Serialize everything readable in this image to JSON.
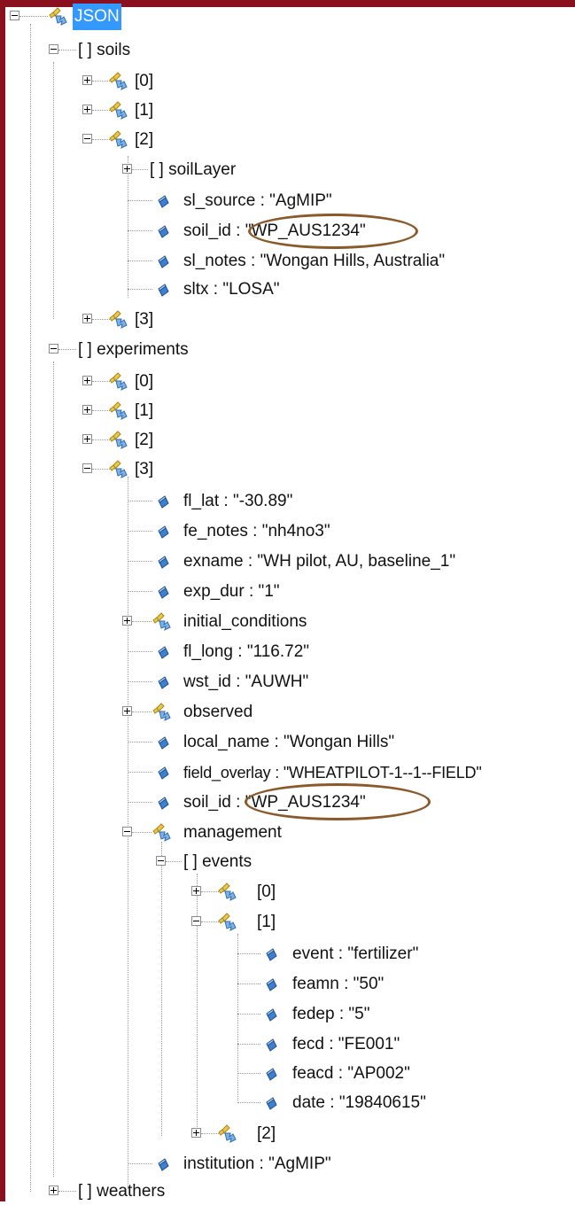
{
  "root": {
    "label": "JSON"
  },
  "soils": {
    "label": "[ ]  soils",
    "items": [
      "[0]",
      "[1]",
      "[2]",
      "[3]"
    ],
    "expanded": {
      "soilLayer": "[ ]  soilLayer",
      "sl_source": "sl_source : \"AgMIP\"",
      "soil_id": "soil_id : \"WP_AUS1234\"",
      "sl_notes": "sl_notes : \"Wongan Hills, Australia\"",
      "sltx": "sltx : \"LOSA\""
    }
  },
  "experiments": {
    "label": "[ ]  experiments",
    "items": [
      "[0]",
      "[1]",
      "[2]",
      "[3]"
    ],
    "expanded": {
      "fl_lat": "fl_lat : \"-30.89\"",
      "fe_notes": "fe_notes : \"nh4no3\"",
      "exname": "exname : \"WH pilot, AU, baseline_1\"",
      "exp_dur": "exp_dur : \"1\"",
      "initial_conditions": "initial_conditions",
      "fl_long": "fl_long : \"116.72\"",
      "wst_id": "wst_id : \"AUWH\"",
      "observed": "observed",
      "local_name": "local_name : \"Wongan Hills\"",
      "field_overlay": "field_overlay : \"WHEATPILOT-1--1--FIELD\"",
      "soil_id": "soil_id : \"WP_AUS1234\"",
      "management": "management",
      "events": "[ ]  events",
      "events_items": [
        "[0]",
        "[1]",
        "[2]"
      ],
      "event1": {
        "event": "event : \"fertilizer\"",
        "feamn": "feamn : \"50\"",
        "fedep": "fedep : \"5\"",
        "fecd": "fecd : \"FE001\"",
        "feacd": "feacd : \"AP002\"",
        "date": "date : \"19840615\""
      },
      "institution": "institution : \"AgMIP\""
    }
  },
  "weathers": {
    "label": "[ ]  weathers"
  },
  "colors": {
    "frame": "#8a0f1f",
    "selection": "#3399ff",
    "highlight_oval": "#8b5a2b"
  }
}
